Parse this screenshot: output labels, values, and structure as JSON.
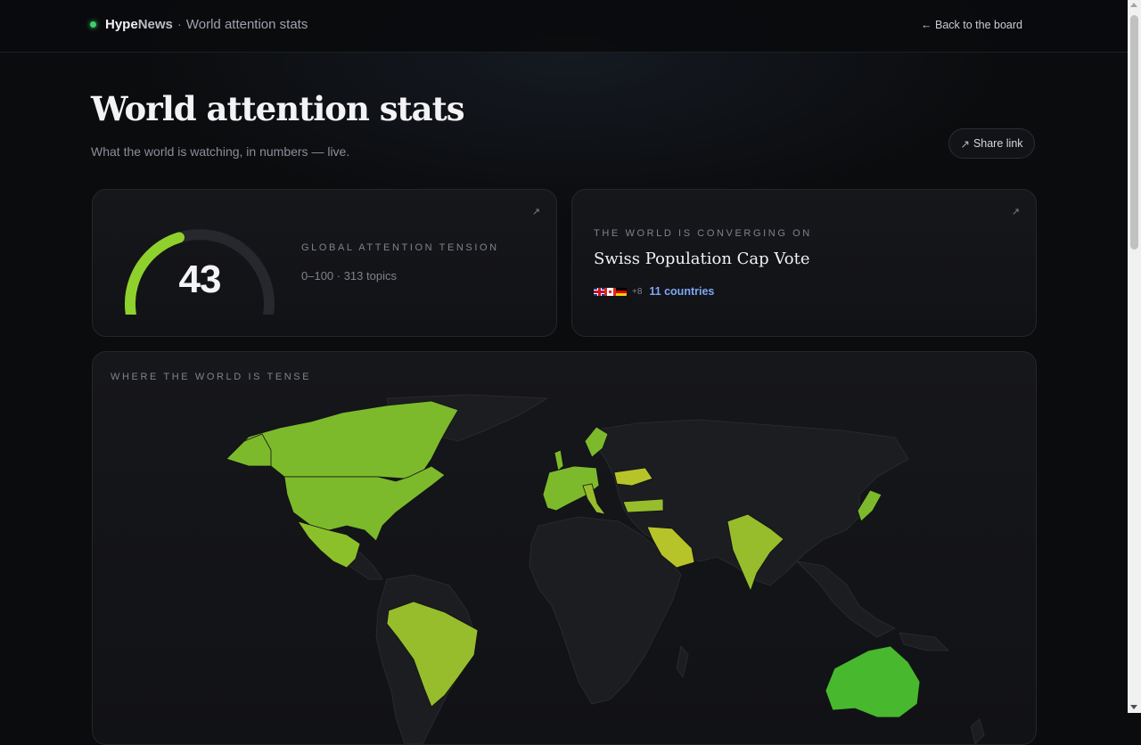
{
  "nav": {
    "brand_hype": "Hype",
    "brand_news": "News",
    "separator": "·",
    "page_name": "World attention stats",
    "back_link": "← Back to the board"
  },
  "header": {
    "title": "World attention stats",
    "subtitle": "What the world is watching, in numbers — live.",
    "share_label": "Share link",
    "share_icon": "↗"
  },
  "tension_card": {
    "value": "43",
    "gauge_fraction": 0.43,
    "label": "Global attention tension",
    "meta": "0–100 · 313 topics",
    "expand_icon": "↗"
  },
  "converge_card": {
    "label": "The world is converging on",
    "topic": "Swiss Population Cap Vote",
    "flags": [
      "gb-flag",
      "ca-flag",
      "de-flag"
    ],
    "more_count": "+8",
    "countries_link": "11 countries",
    "expand_icon": "↗"
  },
  "map_card": {
    "label": "Where the world is tense"
  },
  "colors": {
    "background": "#0b0c0e",
    "accent_green": "#3ecf6a",
    "gauge_fill": "#8fd12c",
    "gauge_track": "#26282d",
    "link_blue": "#7fa6f5",
    "map_land": "#1c1d21",
    "tension_high": "#b6c42a",
    "tension_mid": "#97bd2c",
    "tension_low": "#7cba2c",
    "tension_calm": "#48b82e"
  }
}
